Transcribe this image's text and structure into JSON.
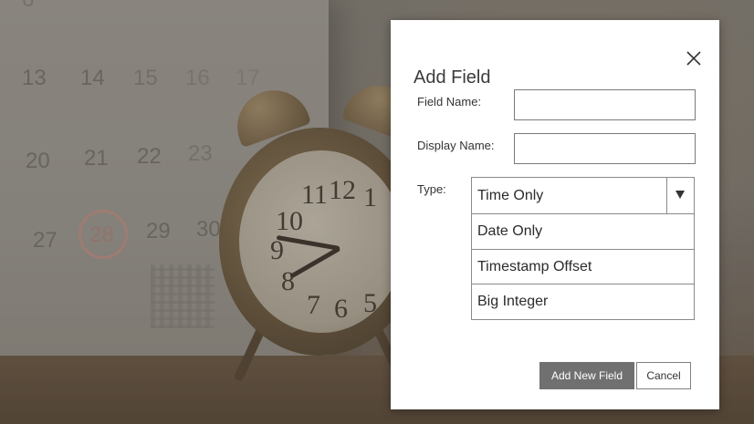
{
  "background": {
    "description_icons": [
      "calendar-photo",
      "alarm-clock-photo"
    ],
    "calendar_numbers": [
      "13",
      "14",
      "15",
      "16",
      "17",
      "20",
      "21",
      "22",
      "23",
      "27",
      "28",
      "29",
      "30"
    ],
    "clock_numbers": [
      "11",
      "12",
      "1",
      "10",
      "9",
      "8",
      "7",
      "6",
      "5"
    ]
  },
  "dialog": {
    "title": "Add Field",
    "close_icon": "close-icon",
    "fields": {
      "field_name_label": "Field Name:",
      "field_name_value": "",
      "display_name_label": "Display Name:",
      "display_name_value": "",
      "type_label": "Type:"
    },
    "type_select": {
      "selected": "Time Only",
      "options": [
        "Date Only",
        "Timestamp Offset",
        "Big Integer"
      ]
    },
    "buttons": {
      "add_label": "Add New Field",
      "cancel_label": "Cancel"
    }
  },
  "colors": {
    "primary_button": "#707070",
    "dialog_background": "#ffffff",
    "border": "#8a8a8a"
  }
}
